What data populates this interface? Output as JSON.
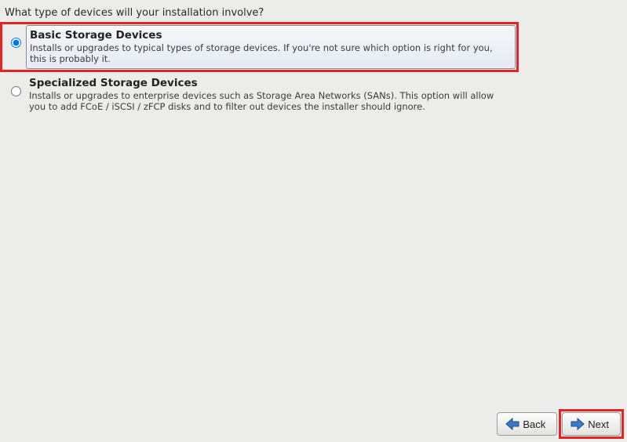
{
  "question": "What type of devices will your installation involve?",
  "options": [
    {
      "id": "basic",
      "title": "Basic Storage Devices",
      "desc": "Installs or upgrades to typical types of storage devices.  If you're not sure which option is right for you, this is probably it.",
      "selected": true,
      "highlighted": true
    },
    {
      "id": "specialized",
      "title": "Specialized Storage Devices",
      "desc": "Installs or upgrades to enterprise devices such as Storage Area Networks (SANs). This option will allow you to add FCoE / iSCSI / zFCP disks and to filter out devices the installer should ignore.",
      "selected": false,
      "highlighted": false
    }
  ],
  "buttons": {
    "back": "Back",
    "next": "Next"
  },
  "next_highlighted": true
}
